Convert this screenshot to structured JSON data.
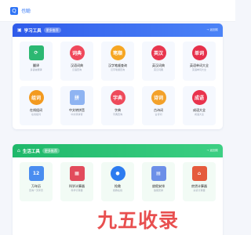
{
  "app": {
    "title": "也聪"
  },
  "study": {
    "title": "学习工具",
    "tag": "更多推荐",
    "more": "→ 返回前",
    "cards": [
      {
        "name": "翻译",
        "desc": "多语言翻译",
        "icon": "swap-icon",
        "glyph": "⟳",
        "color": "#2cb872",
        "shape": "sq"
      },
      {
        "name": "汉语词典",
        "desc": "汉语查询",
        "icon": "dictionary-icon",
        "glyph": "词典",
        "color": "#f0485b",
        "shape": "circle"
      },
      {
        "name": "汉字笔顺查询",
        "desc": "汉字笔顺查询",
        "icon": "pen-icon",
        "glyph": "笔顺",
        "color": "#f6a623",
        "shape": "circle"
      },
      {
        "name": "英汉词典",
        "desc": "英汉词典",
        "icon": "english-icon",
        "glyph": "英汉",
        "color": "#e8364e",
        "shape": "circle"
      },
      {
        "name": "英语单词大全",
        "desc": "英语单词大全",
        "icon": "words-icon",
        "glyph": "单词",
        "color": "#e6304b",
        "shape": "circle"
      },
      {
        "name": "在线组词",
        "desc": "在线组词",
        "icon": "compose-icon",
        "glyph": "组词",
        "color": "#f39a1f",
        "shape": "circle"
      },
      {
        "name": "中文转拼音",
        "desc": "中文转拼音",
        "icon": "pinyin-icon",
        "glyph": "拼",
        "color": "#8fb4f2",
        "shape": "sq"
      },
      {
        "name": "字典",
        "desc": "字典查询",
        "icon": "character-icon",
        "glyph": "字典",
        "color": "#ee4a5b",
        "shape": "circle"
      },
      {
        "name": "古诗词",
        "desc": "古诗词",
        "icon": "poem-icon",
        "glyph": "诗词",
        "color": "#f3a12a",
        "shape": "circle"
      },
      {
        "name": "成语大全",
        "desc": "成语大全",
        "icon": "idiom-icon",
        "glyph": "成语",
        "color": "#e9334d",
        "shape": "circle"
      }
    ]
  },
  "life": {
    "title": "生活工具",
    "tag": "更多推荐",
    "more": "→ 返回前",
    "cards": [
      {
        "name": "万年历",
        "desc": "查询一天年历",
        "icon": "calendar-icon",
        "glyph": "12",
        "color": "#4a8df0",
        "shape": "sq"
      },
      {
        "name": "科学计算器",
        "desc": "科学计算器",
        "icon": "calculator-icon",
        "glyph": "▦",
        "color": "#e24b5c",
        "shape": "sq"
      },
      {
        "name": "抢救",
        "desc": "抢救在线",
        "icon": "drop-icon",
        "glyph": "●",
        "color": "#2d7cf0",
        "shape": "circle"
      },
      {
        "name": "放假安排",
        "desc": "放假安排",
        "icon": "holiday-icon",
        "glyph": "▤",
        "color": "#6c8fe8",
        "shape": "sq"
      },
      {
        "name": "房贷计算器",
        "desc": "房贷计算器",
        "icon": "house-icon",
        "glyph": "⌂",
        "color": "#e55b3c",
        "shape": "sq"
      }
    ]
  },
  "watermark": "九五收录"
}
